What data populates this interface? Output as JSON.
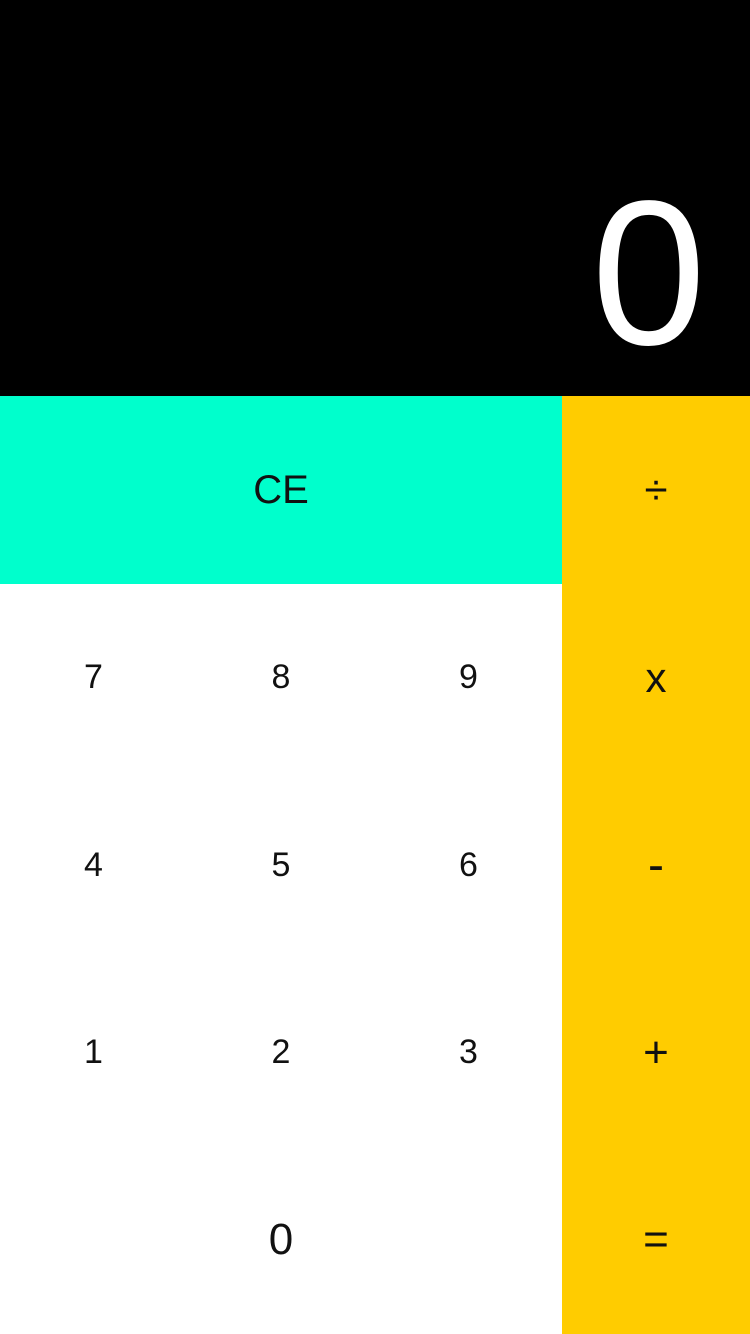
{
  "display": {
    "value": "0"
  },
  "keys": {
    "ce": "CE",
    "divide": "÷",
    "multiply": "x",
    "subtract": "-",
    "add": "+",
    "equals": "=",
    "d7": "7",
    "d8": "8",
    "d9": "9",
    "d4": "4",
    "d5": "5",
    "d6": "6",
    "d1": "1",
    "d2": "2",
    "d3": "3",
    "d0": "0"
  },
  "colors": {
    "display_bg": "#000000",
    "display_text": "#ffffff",
    "clear_key": "#00ffcc",
    "operator_key": "#ffcc00",
    "digit_key": "#ffffff"
  }
}
